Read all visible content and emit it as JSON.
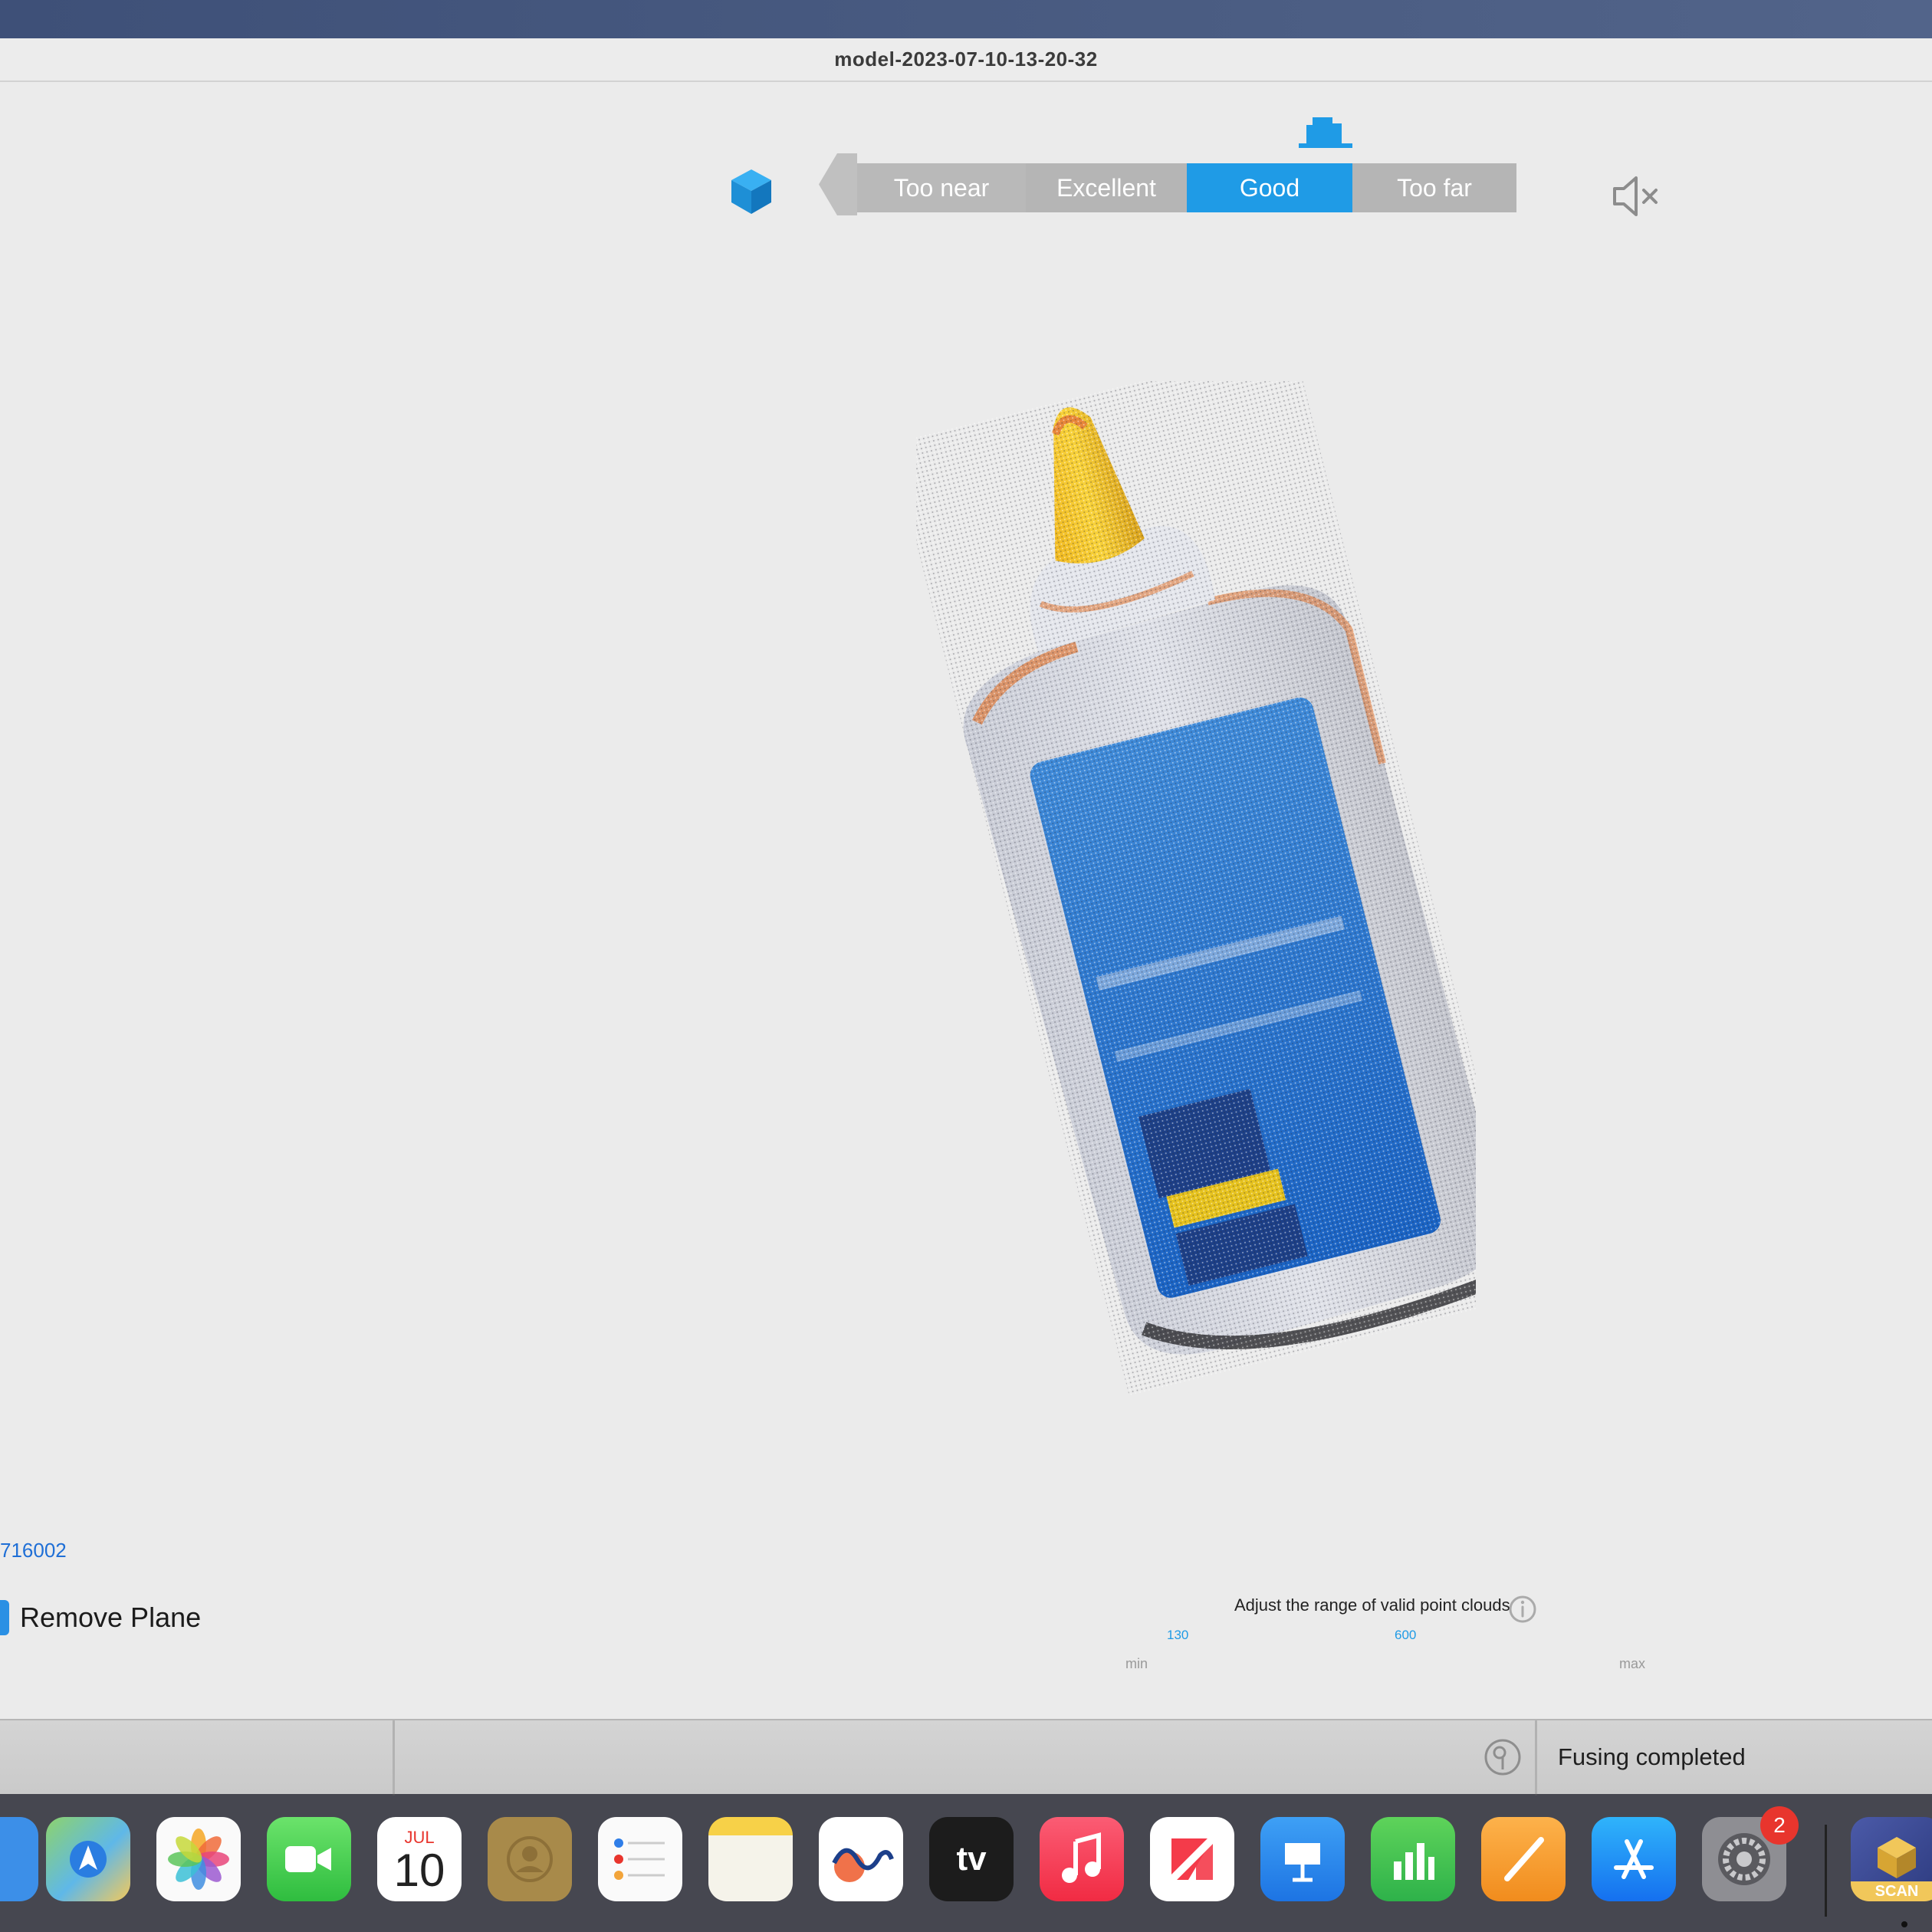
{
  "window": {
    "title": "model-2023-07-10-13-20-32"
  },
  "distance": {
    "segments": [
      "Too near",
      "Excellent",
      "Good",
      "Too far"
    ],
    "active": "Good"
  },
  "model_id": "716002",
  "remove_plane": {
    "label": "Remove Plane"
  },
  "range": {
    "title": "Adjust the range of valid point clouds",
    "min_label": "min",
    "max_label": "max",
    "low": "130",
    "high": "600"
  },
  "status": {
    "text": "Fusing completed"
  },
  "dock": {
    "calendar_month": "JUL",
    "calendar_day": "10",
    "tv_label": "tv",
    "settings_badge": "2",
    "scan_label": "SCAN",
    "apps": [
      "finder-icon",
      "maps-icon",
      "photos-icon",
      "facetime-icon",
      "calendar-icon",
      "contacts-icon",
      "reminders-icon",
      "notes-icon",
      "freeform-icon",
      "apple-tv-icon",
      "music-icon",
      "news-icon",
      "keynote-icon",
      "numbers-icon",
      "pages-icon",
      "app-store-icon",
      "system-settings-icon",
      "scan-app-icon"
    ]
  },
  "colors": {
    "accent": "#1f9be6",
    "segment": "#b5b5b5",
    "background": "#ebebeb",
    "desktop": "#3e5078"
  }
}
